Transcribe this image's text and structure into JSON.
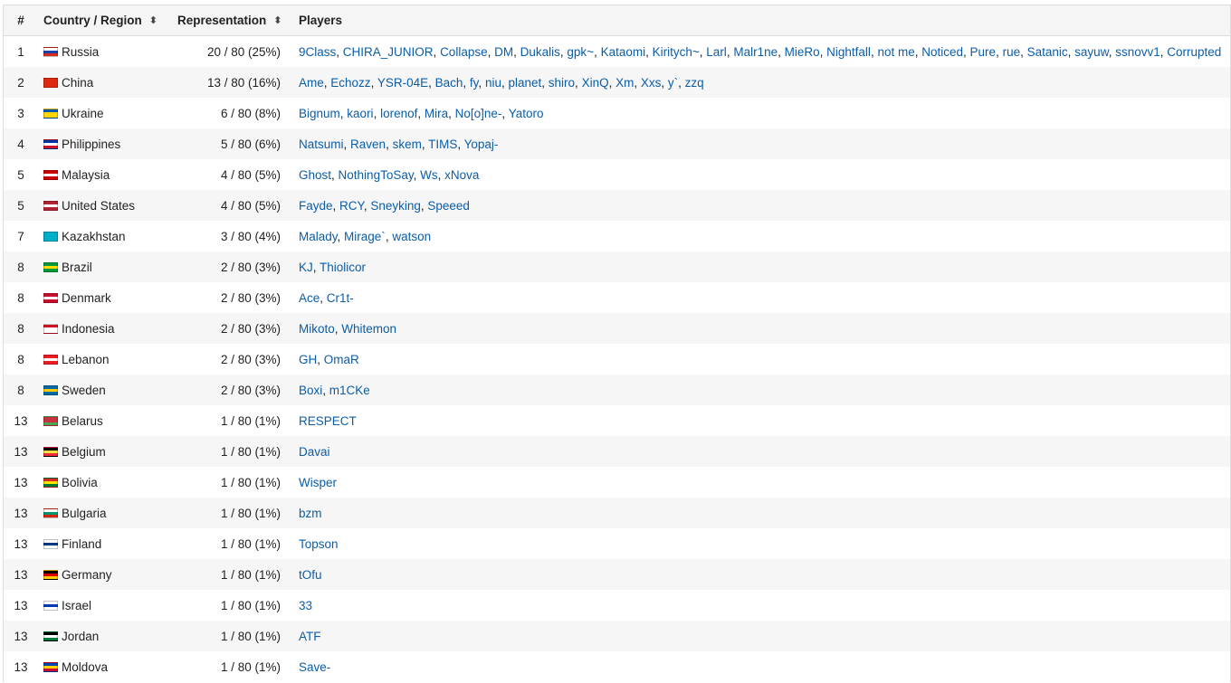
{
  "table": {
    "headers": {
      "rank": "#",
      "country": "Country / Region",
      "representation": "Representation",
      "players": "Players",
      "sort_icon": "sort-arrows-icon"
    },
    "rows": [
      {
        "rank": "1",
        "country": "Russia",
        "flag": "russia-flag-icon",
        "flag_colors": [
          "#ffffff",
          "#1c3fa8",
          "#d52b1e"
        ],
        "rep": "20 / 80 (25%)",
        "players": [
          "9Class",
          "CHIRA_JUNIOR",
          "Collapse",
          "DM",
          "Dukalis",
          "gpk~",
          "Kataomi",
          "Kiritych~",
          "Larl",
          "Malr1ne",
          "MieRo",
          "Nightfall",
          "not me",
          "Noticed",
          "Pure",
          "rue",
          "Satanic",
          "sayuw",
          "ssnovv1",
          "Corrupted"
        ]
      },
      {
        "rank": "2",
        "country": "China",
        "flag": "china-flag-icon",
        "flag_colors": [
          "#de2910",
          "#de2910",
          "#de2910"
        ],
        "rep": "13 / 80 (16%)",
        "players": [
          "Ame",
          "Echozz",
          "YSR-04E",
          "Bach",
          "fy",
          "niu",
          "planet",
          "shiro",
          "XinQ",
          "Xm",
          "Xxs",
          "y`",
          "zzq"
        ]
      },
      {
        "rank": "3",
        "country": "Ukraine",
        "flag": "ukraine-flag-icon",
        "flag_colors": [
          "#0057b7",
          "#ffd700",
          "#ffd700"
        ],
        "rep": "6 / 80 (8%)",
        "players": [
          "Bignum",
          "kaori",
          "lorenof",
          "Mira",
          "No[o]ne-",
          "Yatoro"
        ]
      },
      {
        "rank": "4",
        "country": "Philippines",
        "flag": "philippines-flag-icon",
        "flag_colors": [
          "#0038a8",
          "#ffffff",
          "#ce1126"
        ],
        "rep": "5 / 80 (6%)",
        "players": [
          "Natsumi",
          "Raven",
          "skem",
          "TIMS",
          "Yopaj-"
        ]
      },
      {
        "rank": "5",
        "country": "Malaysia",
        "flag": "malaysia-flag-icon",
        "flag_colors": [
          "#cc0001",
          "#ffffff",
          "#cc0001"
        ],
        "rep": "4 / 80 (5%)",
        "players": [
          "Ghost",
          "NothingToSay",
          "Ws",
          "xNova"
        ]
      },
      {
        "rank": "5",
        "country": "United States",
        "flag": "usa-flag-icon",
        "flag_colors": [
          "#b22234",
          "#ffffff",
          "#b22234"
        ],
        "rep": "4 / 80 (5%)",
        "players": [
          "Fayde",
          "RCY",
          "Sneyking",
          "Speeed"
        ]
      },
      {
        "rank": "7",
        "country": "Kazakhstan",
        "flag": "kazakhstan-flag-icon",
        "flag_colors": [
          "#00afca",
          "#00afca",
          "#00afca"
        ],
        "rep": "3 / 80 (4%)",
        "players": [
          "Malady",
          "Mirage`",
          "watson"
        ]
      },
      {
        "rank": "8",
        "country": "Brazil",
        "flag": "brazil-flag-icon",
        "flag_colors": [
          "#009c3b",
          "#ffdf00",
          "#009c3b"
        ],
        "rep": "2 / 80 (3%)",
        "players": [
          "KJ",
          "Thiolicor"
        ]
      },
      {
        "rank": "8",
        "country": "Denmark",
        "flag": "denmark-flag-icon",
        "flag_colors": [
          "#c8102e",
          "#ffffff",
          "#c8102e"
        ],
        "rep": "2 / 80 (3%)",
        "players": [
          "Ace",
          "Cr1t-"
        ]
      },
      {
        "rank": "8",
        "country": "Indonesia",
        "flag": "indonesia-flag-icon",
        "flag_colors": [
          "#ce1126",
          "#ffffff",
          "#ffffff"
        ],
        "rep": "2 / 80 (3%)",
        "players": [
          "Mikoto",
          "Whitemon"
        ]
      },
      {
        "rank": "8",
        "country": "Lebanon",
        "flag": "lebanon-flag-icon",
        "flag_colors": [
          "#ed1c24",
          "#ffffff",
          "#ed1c24"
        ],
        "rep": "2 / 80 (3%)",
        "players": [
          "GH",
          "OmaR"
        ]
      },
      {
        "rank": "8",
        "country": "Sweden",
        "flag": "sweden-flag-icon",
        "flag_colors": [
          "#006aa7",
          "#fecc00",
          "#006aa7"
        ],
        "rep": "2 / 80 (3%)",
        "players": [
          "Boxi",
          "m1CKe"
        ]
      },
      {
        "rank": "13",
        "country": "Belarus",
        "flag": "belarus-flag-icon",
        "flag_colors": [
          "#c8313e",
          "#c8313e",
          "#4aa657"
        ],
        "rep": "1 / 80 (1%)",
        "players": [
          "RESPECT"
        ]
      },
      {
        "rank": "13",
        "country": "Belgium",
        "flag": "belgium-flag-icon",
        "flag_colors": [
          "#000000",
          "#fae042",
          "#ed2939"
        ],
        "rep": "1 / 80 (1%)",
        "players": [
          "Davai"
        ]
      },
      {
        "rank": "13",
        "country": "Bolivia",
        "flag": "bolivia-flag-icon",
        "flag_colors": [
          "#d52b1e",
          "#f9e300",
          "#007934"
        ],
        "rep": "1 / 80 (1%)",
        "players": [
          "Wisper"
        ]
      },
      {
        "rank": "13",
        "country": "Bulgaria",
        "flag": "bulgaria-flag-icon",
        "flag_colors": [
          "#ffffff",
          "#00966e",
          "#d62612"
        ],
        "rep": "1 / 80 (1%)",
        "players": [
          "bzm"
        ]
      },
      {
        "rank": "13",
        "country": "Finland",
        "flag": "finland-flag-icon",
        "flag_colors": [
          "#ffffff",
          "#003580",
          "#ffffff"
        ],
        "rep": "1 / 80 (1%)",
        "players": [
          "Topson"
        ]
      },
      {
        "rank": "13",
        "country": "Germany",
        "flag": "germany-flag-icon",
        "flag_colors": [
          "#000000",
          "#dd0000",
          "#ffce00"
        ],
        "rep": "1 / 80 (1%)",
        "players": [
          "tOfu"
        ]
      },
      {
        "rank": "13",
        "country": "Israel",
        "flag": "israel-flag-icon",
        "flag_colors": [
          "#ffffff",
          "#0038b8",
          "#ffffff"
        ],
        "rep": "1 / 80 (1%)",
        "players": [
          "33"
        ]
      },
      {
        "rank": "13",
        "country": "Jordan",
        "flag": "jordan-flag-icon",
        "flag_colors": [
          "#000000",
          "#ffffff",
          "#007a3d"
        ],
        "rep": "1 / 80 (1%)",
        "players": [
          "ATF"
        ]
      },
      {
        "rank": "13",
        "country": "Moldova",
        "flag": "moldova-flag-icon",
        "flag_colors": [
          "#0046ae",
          "#ffd200",
          "#cc092f"
        ],
        "rep": "1 / 80 (1%)",
        "players": [
          "Save-"
        ]
      }
    ]
  }
}
